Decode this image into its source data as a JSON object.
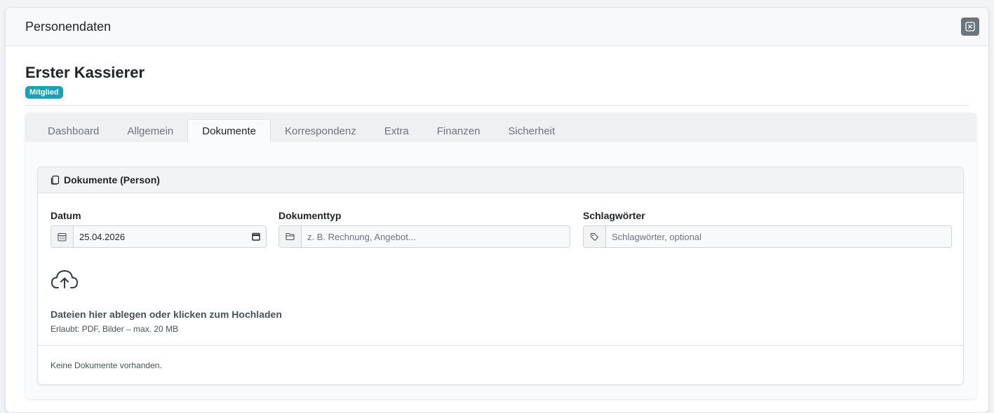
{
  "modal": {
    "title": "Personendaten"
  },
  "person": {
    "name": "Erster Kassierer",
    "badge": "Mitglied"
  },
  "tabs": [
    {
      "label": "Dashboard",
      "active": false
    },
    {
      "label": "Allgemein",
      "active": false
    },
    {
      "label": "Dokumente",
      "active": true
    },
    {
      "label": "Korrespondenz",
      "active": false
    },
    {
      "label": "Extra",
      "active": false
    },
    {
      "label": "Finanzen",
      "active": false
    },
    {
      "label": "Sicherheit",
      "active": false
    }
  ],
  "documents": {
    "card_title": "Dokumente (Person)",
    "fields": {
      "datum": {
        "label": "Datum",
        "value": "25.04.2026"
      },
      "dokumenttyp": {
        "label": "Dokumenttyp",
        "placeholder": "z. B. Rechnung, Angebot..."
      },
      "schlagwoerter": {
        "label": "Schlagwörter",
        "placeholder": "Schlagwörter, optional"
      }
    },
    "upload": {
      "title": "Dateien hier ablegen oder klicken zum Hochladen",
      "hint": "Erlaubt: PDF, Bilder – max. 20 MB"
    },
    "empty_text": "Keine Dokumente vorhanden."
  },
  "colors": {
    "badge": "#17a2b8",
    "close_button": "#6c757d",
    "header_bg": "#f8f9fa"
  },
  "icons": [
    "close-icon",
    "copy-icon",
    "calendar-icon",
    "folder-icon",
    "tag-icon",
    "cloud-upload-icon"
  ]
}
